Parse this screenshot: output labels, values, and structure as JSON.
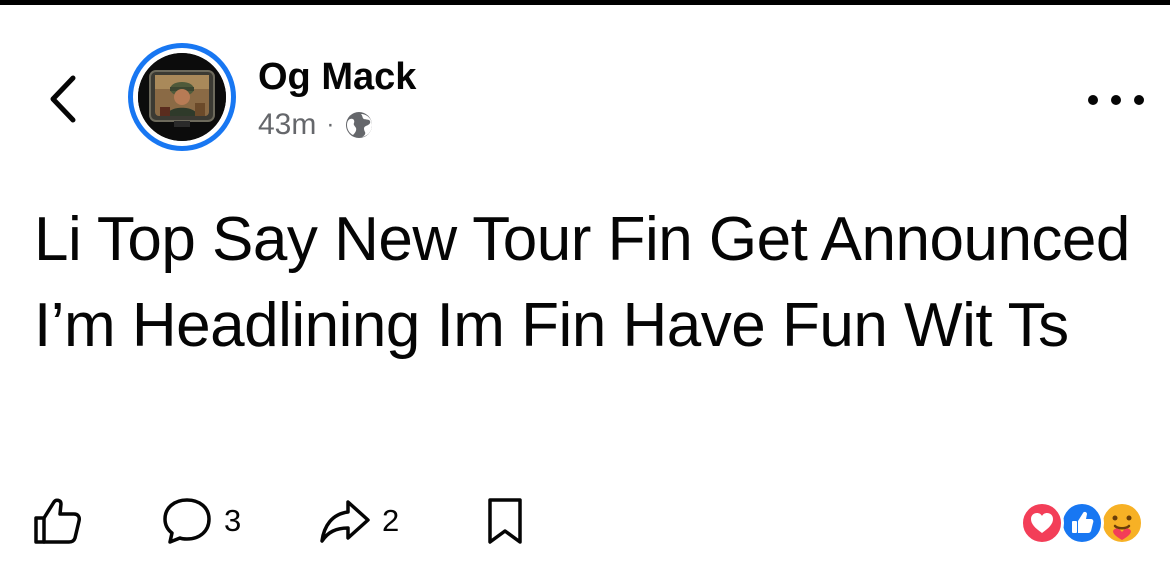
{
  "post": {
    "author": "Og Mack",
    "time": "43m",
    "separator": "·",
    "audience_icon": "globe-icon",
    "text": "Li Top Say New Tour Fin Get Announced I’m Headlining Im Fin Have Fun Wit Ts"
  },
  "header": {
    "back_icon": "chevron-left-icon",
    "more_icon": "more-horizontal-icon"
  },
  "actions": {
    "like": {
      "icon": "thumbs-up-icon"
    },
    "comment": {
      "icon": "comment-icon",
      "count": "3"
    },
    "share": {
      "icon": "share-icon",
      "count": "2"
    },
    "save": {
      "icon": "bookmark-icon"
    }
  },
  "reactions": [
    "love",
    "like",
    "care"
  ],
  "colors": {
    "accent": "#1877f2",
    "love": "#f33e58",
    "like": "#1877f2",
    "care": "#f7b125",
    "meta_text": "#65676b"
  }
}
